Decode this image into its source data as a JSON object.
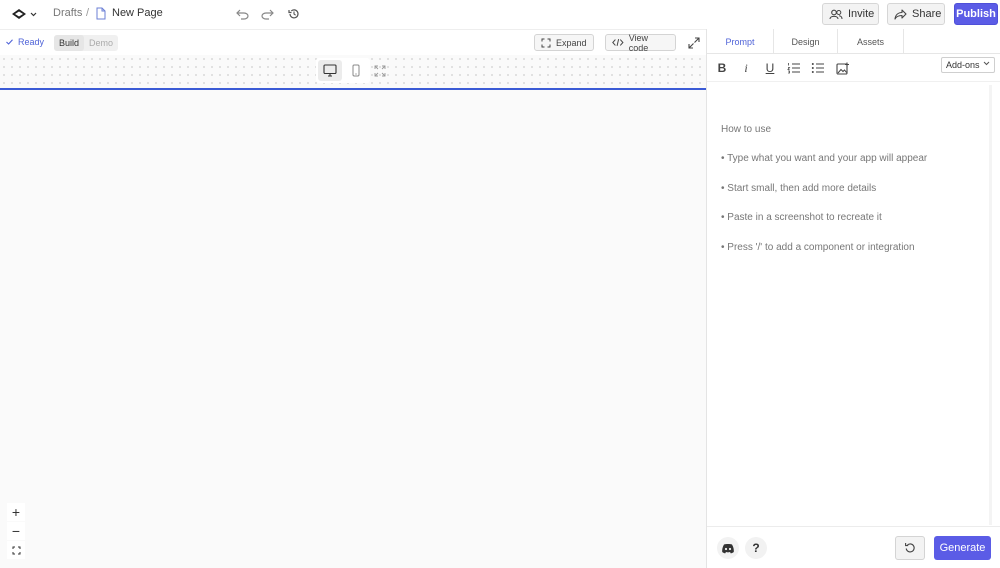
{
  "header": {
    "breadcrumb_root": "Drafts",
    "breadcrumb_sep": "/",
    "page_name": "New Page",
    "invite_label": "Invite",
    "share_label": "Share",
    "publish_label": "Publish"
  },
  "toolbar": {
    "status": "Ready",
    "mode_build": "Build",
    "mode_demo": "Demo",
    "expand_label": "Expand",
    "view_code_label": "View code"
  },
  "panel": {
    "tabs": [
      "Prompt",
      "Design",
      "Assets"
    ],
    "active_tab": "Prompt",
    "addons_label": "Add-ons",
    "help_title": "How to use",
    "help_items": [
      "• Type what you want and your app will appear",
      "• Start small, then add more details",
      "• Paste in a screenshot to recreate it",
      "• Press '/' to add a component or integration"
    ],
    "help_glyph": "?",
    "generate_label": "Generate"
  },
  "zoom": {
    "in": "+",
    "out": "−"
  },
  "format": {
    "bold": "B",
    "italic": "i",
    "underline": "U"
  },
  "colors": {
    "accent": "#5b5ce6",
    "link": "#4f63d8",
    "divider": "#3b5bd6"
  },
  "icons": [
    "logo-icon",
    "chevron-down-icon",
    "file-icon",
    "undo-icon",
    "redo-icon",
    "history-icon",
    "users-icon",
    "share-icon",
    "check-icon",
    "expand-icon",
    "code-icon",
    "maximize-icon",
    "desktop-icon",
    "mobile-icon",
    "fullscreen-icon",
    "ordered-list-icon",
    "bullet-list-icon",
    "image-icon",
    "discord-icon",
    "help-icon",
    "reset-icon"
  ]
}
